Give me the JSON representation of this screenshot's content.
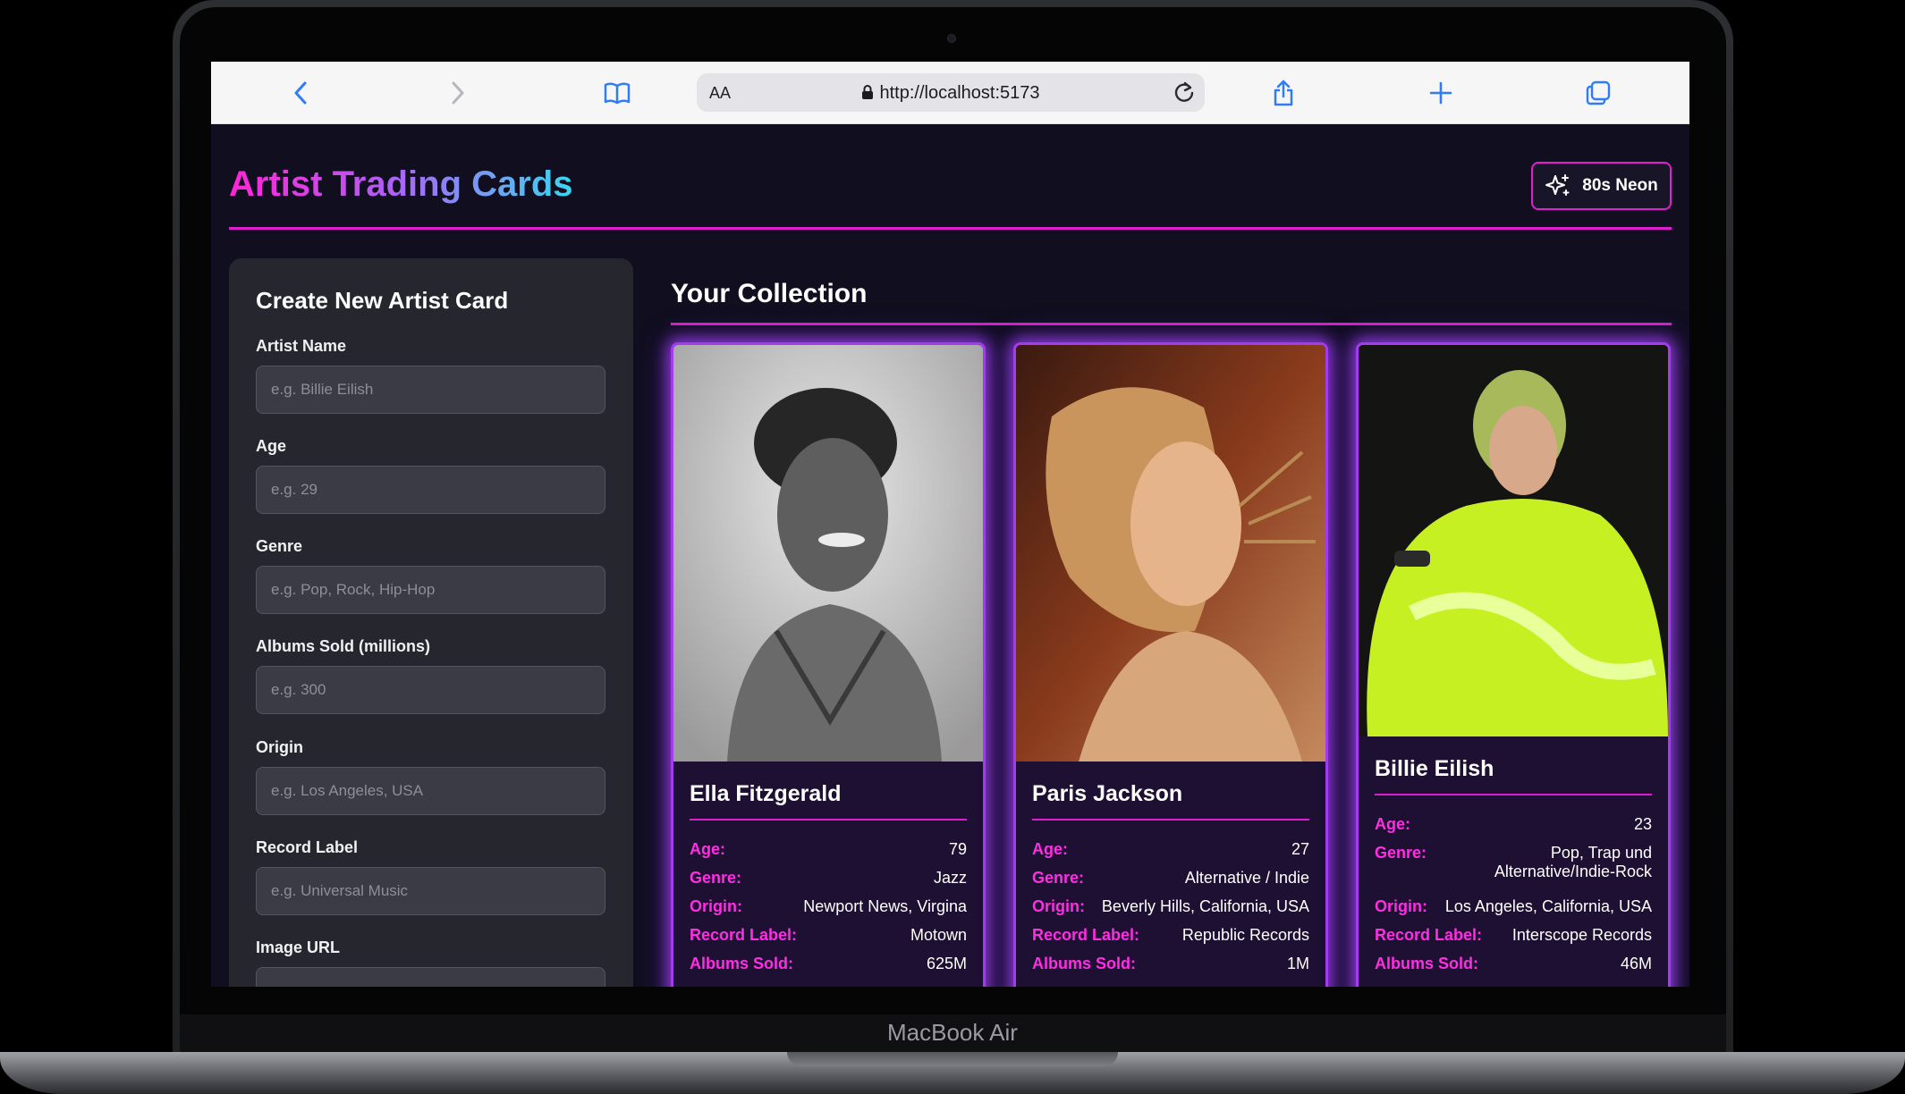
{
  "device": {
    "label": "MacBook Air"
  },
  "browser": {
    "reader_label": "AA",
    "url": "http://localhost:5173"
  },
  "header": {
    "title": "Artist Trading Cards",
    "theme_button": "80s Neon"
  },
  "form": {
    "title": "Create New Artist Card",
    "fields": [
      {
        "label": "Artist Name",
        "placeholder": "e.g. Billie Eilish"
      },
      {
        "label": "Age",
        "placeholder": "e.g. 29"
      },
      {
        "label": "Genre",
        "placeholder": "e.g. Pop, Rock, Hip-Hop"
      },
      {
        "label": "Albums Sold (millions)",
        "placeholder": "e.g. 300"
      },
      {
        "label": "Origin",
        "placeholder": "e.g. Los Angeles, USA"
      },
      {
        "label": "Record Label",
        "placeholder": "e.g. Universal Music"
      },
      {
        "label": "Image URL",
        "placeholder": ""
      }
    ]
  },
  "collection": {
    "title": "Your Collection",
    "keys": {
      "age": "Age:",
      "genre": "Genre:",
      "origin": "Origin:",
      "label": "Record Label:",
      "sold": "Albums Sold:"
    },
    "cards": [
      {
        "name": "Ella Fitzgerald",
        "age": "79",
        "genre": "Jazz",
        "origin": "Newport News, Virgina",
        "label": "Motown",
        "sold": "625M"
      },
      {
        "name": "Paris Jackson",
        "age": "27",
        "genre": "Alternative / Indie",
        "origin": "Beverly Hills, California, USA",
        "label": "Republic Records",
        "sold": "1M"
      },
      {
        "name": "Billie Eilish",
        "age": "23",
        "genre": "Pop, Trap und Alternative/Indie-Rock",
        "origin": "Los Angeles, California, USA",
        "label": "Interscope Records",
        "sold": "46M"
      }
    ]
  }
}
